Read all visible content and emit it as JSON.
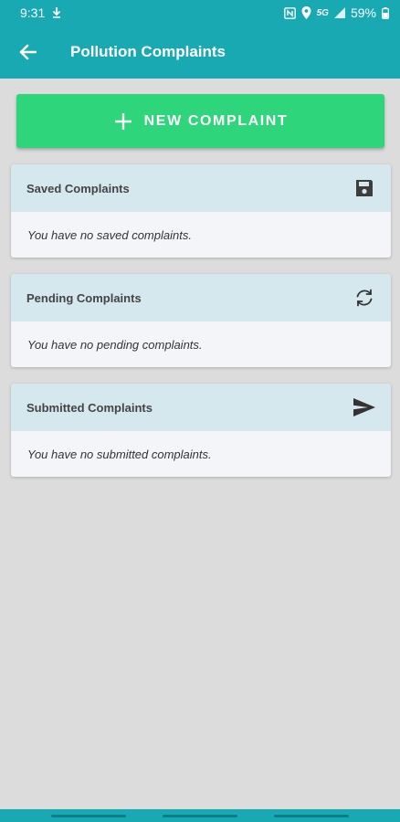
{
  "status_bar": {
    "time": "9:31",
    "network": "5G",
    "battery": "59%"
  },
  "app_bar": {
    "title": "Pollution Complaints"
  },
  "new_complaint_button": {
    "label": "NEW COMPLAINT"
  },
  "cards": [
    {
      "title": "Saved Complaints",
      "icon": "save-icon",
      "empty_text": "You have no saved complaints."
    },
    {
      "title": "Pending Complaints",
      "icon": "sync-icon",
      "empty_text": "You have no pending complaints."
    },
    {
      "title": "Submitted Complaints",
      "icon": "send-icon",
      "empty_text": "You have no submitted complaints."
    }
  ],
  "colors": {
    "primary": "#19a9b3",
    "accent_button": "#2ed57a",
    "card_header": "#d4e8ee",
    "background": "#dcdcdc"
  }
}
